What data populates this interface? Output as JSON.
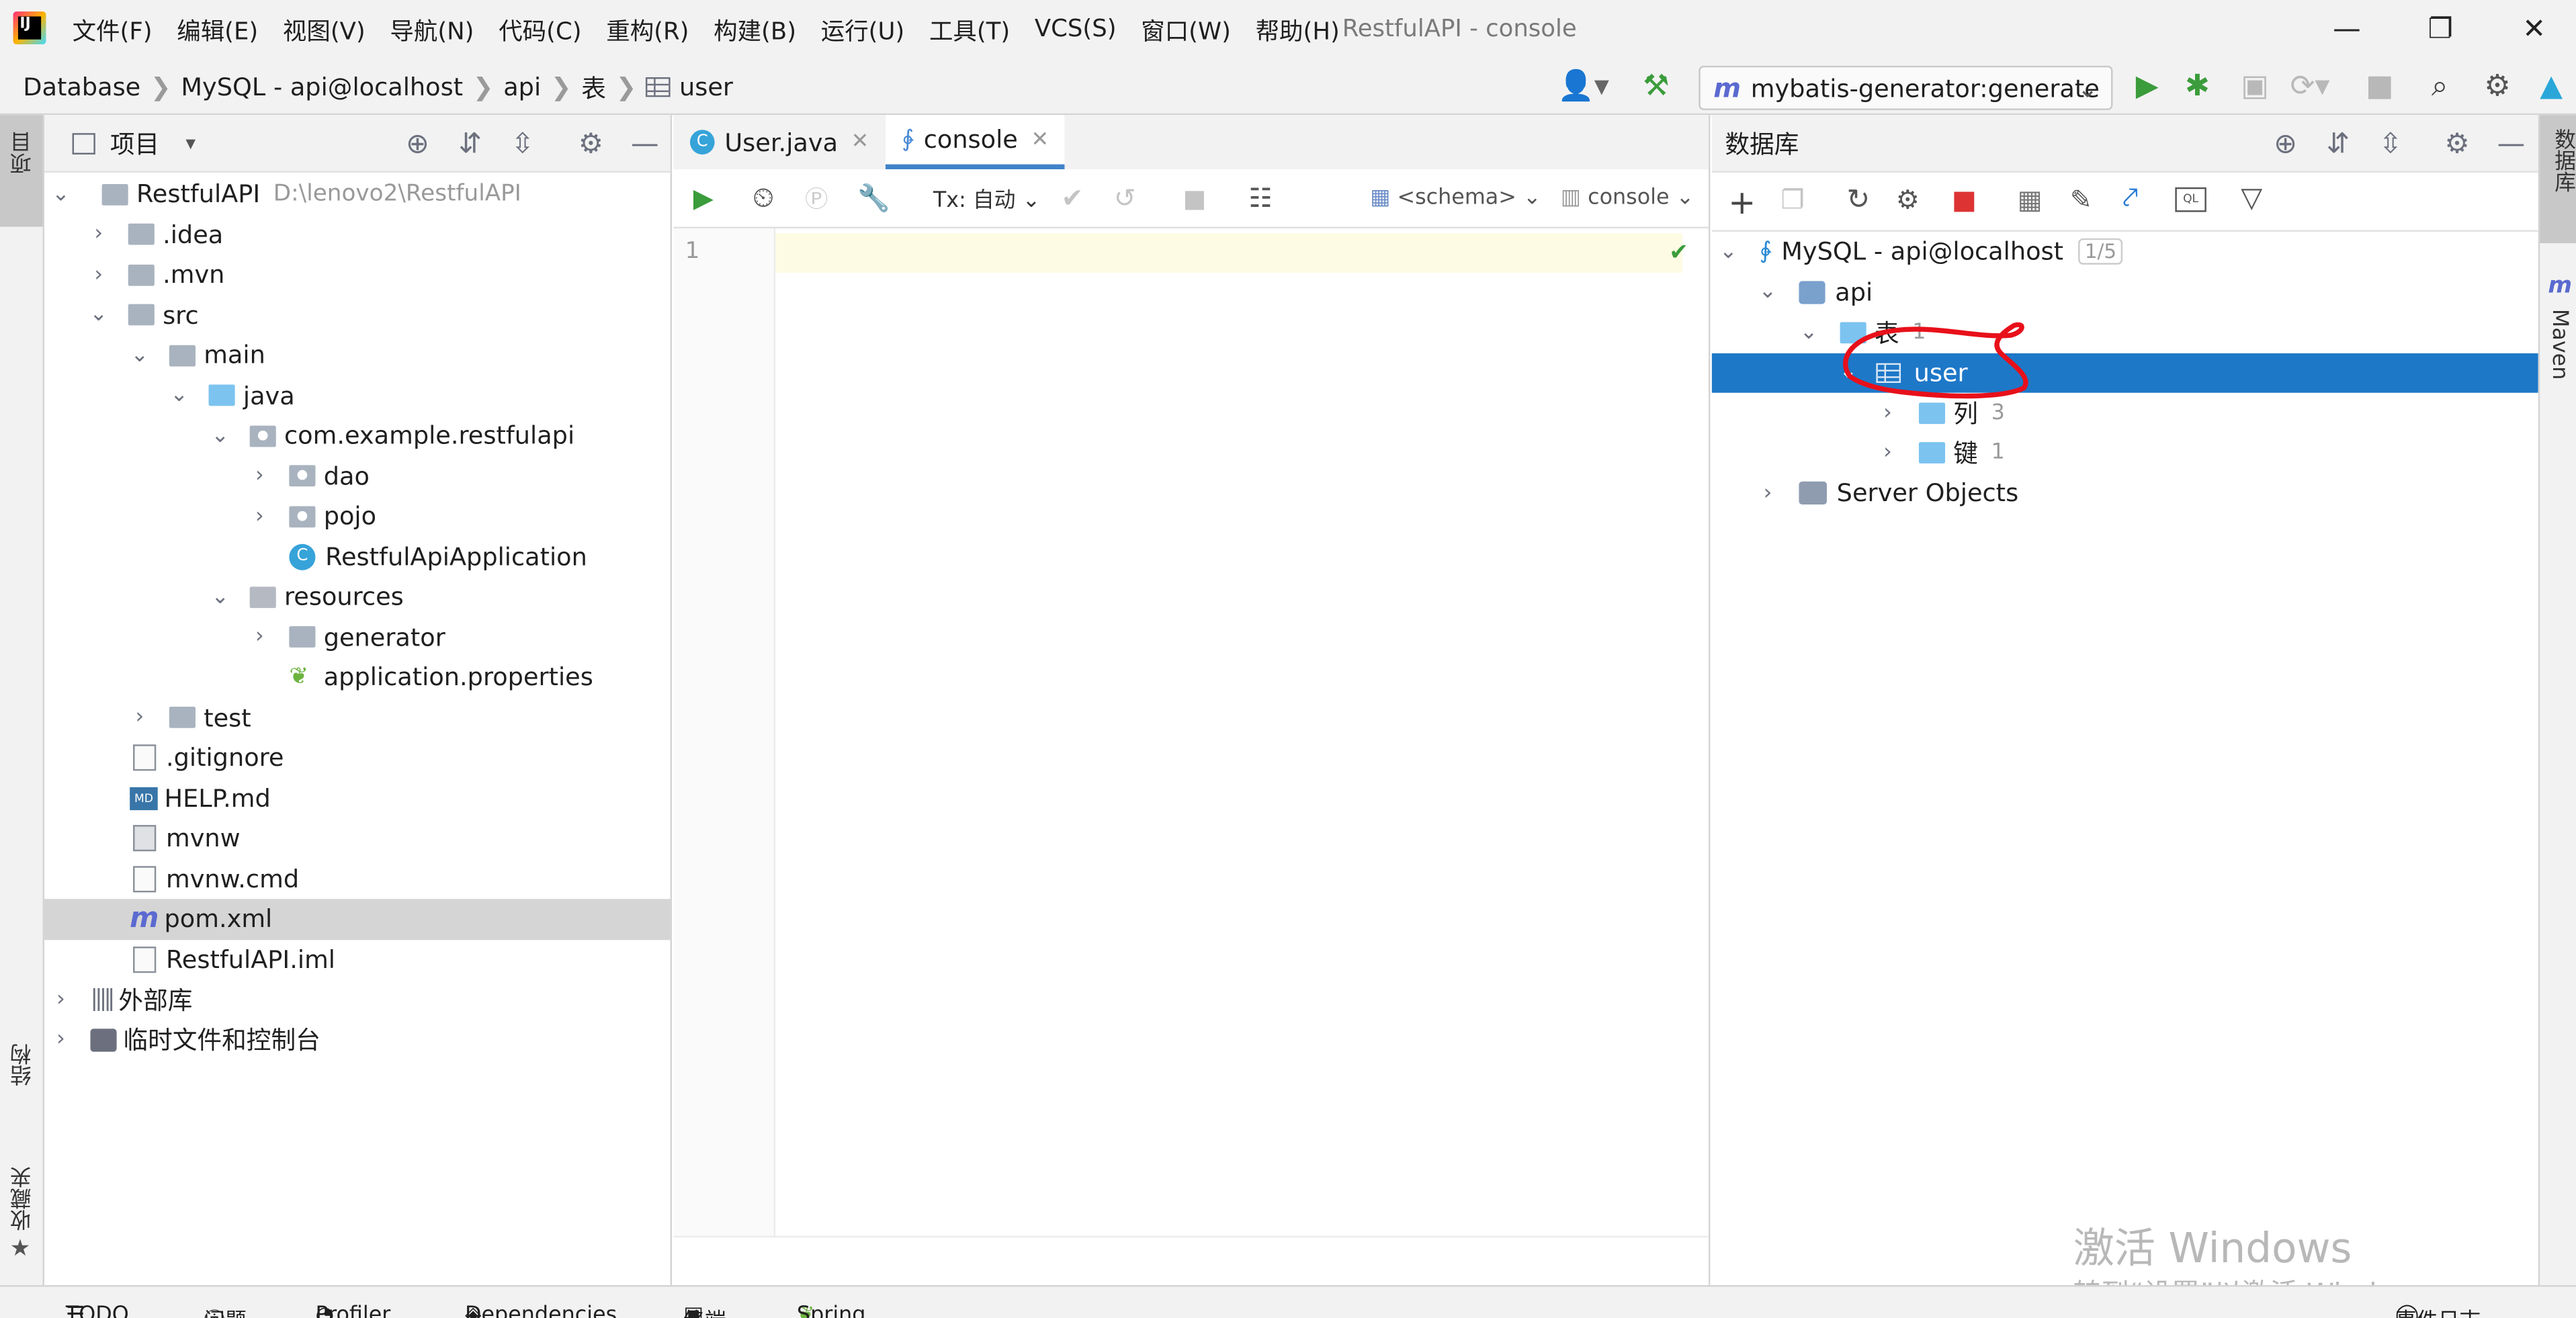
{
  "window": {
    "title": "RestfulAPI - console"
  },
  "menu": [
    "文件(F)",
    "编辑(E)",
    "视图(V)",
    "导航(N)",
    "代码(C)",
    "重构(R)",
    "构建(B)",
    "运行(U)",
    "工具(T)",
    "VCS(S)",
    "窗口(W)",
    "帮助(H)"
  ],
  "breadcrumb": [
    "Database",
    "MySQL - api@localhost",
    "api",
    "表",
    "user"
  ],
  "run_config": {
    "label": "mybatis-generator:generate"
  },
  "left_strip": {
    "project": "项目",
    "structure": "结构",
    "favorites": "收藏夹"
  },
  "right_strip": {
    "database": "数据库",
    "maven": "Maven"
  },
  "project_panel": {
    "title": "项目",
    "tree": [
      {
        "label": "RestfulAPI",
        "path": "D:\\lenovo2\\RestfulAPI"
      },
      {
        "label": ".idea"
      },
      {
        "label": ".mvn"
      },
      {
        "label": "src"
      },
      {
        "label": "main"
      },
      {
        "label": "java"
      },
      {
        "label": "com.example.restfulapi"
      },
      {
        "label": "dao"
      },
      {
        "label": "pojo"
      },
      {
        "label": "RestfulApiApplication"
      },
      {
        "label": "resources"
      },
      {
        "label": "generator"
      },
      {
        "label": "application.properties"
      },
      {
        "label": "test"
      },
      {
        "label": ".gitignore"
      },
      {
        "label": "HELP.md"
      },
      {
        "label": "mvnw"
      },
      {
        "label": "mvnw.cmd"
      },
      {
        "label": "pom.xml"
      },
      {
        "label": "RestfulAPI.iml"
      },
      {
        "label": "外部库"
      },
      {
        "label": "临时文件和控制台"
      }
    ]
  },
  "editor": {
    "tabs": [
      {
        "label": "User.java"
      },
      {
        "label": "console"
      }
    ],
    "tx_mode": "Tx: 自动",
    "schema": "<schema>",
    "session": "console",
    "line_number": "1"
  },
  "db_panel": {
    "title": "数据库",
    "tree": [
      {
        "label": "MySQL - api@localhost",
        "count": "1/5"
      },
      {
        "label": "api"
      },
      {
        "label": "表",
        "count": "1"
      },
      {
        "label": "user"
      },
      {
        "label": "列",
        "count": "3"
      },
      {
        "label": "键",
        "count": "1"
      },
      {
        "label": "Server Objects"
      }
    ]
  },
  "statusbar": [
    "TODO",
    "问题",
    "Profiler",
    "Dependencies",
    "终端",
    "Spring",
    "事件日志"
  ],
  "watermark": {
    "line1": "激活 Windows",
    "line2": "转到“设置”以激活 Windows。"
  },
  "colors": {
    "selection": "#1e78c8",
    "annotation": "#e8101a",
    "accent": "#4083c9"
  }
}
